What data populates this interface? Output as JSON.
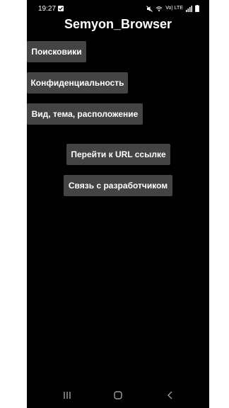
{
  "status_bar": {
    "time": "19:27",
    "icons": [
      "mute-icon",
      "wifi-icon",
      "lte-icon",
      "signal-icon",
      "battery-icon"
    ],
    "lte_label": "Vo) LTE"
  },
  "app": {
    "title": "Semyon_Browser"
  },
  "buttons": {
    "search_engines": "Поисковики",
    "privacy": "Конфиденциальность",
    "view_theme_layout": "Вид, тема, расположение",
    "go_to_url": "Перейти к URL ссылке",
    "contact_developer": "Связь с разработчиком"
  },
  "colors": {
    "background": "#000000",
    "button_bg": "#444444",
    "text": "#ffffff"
  }
}
